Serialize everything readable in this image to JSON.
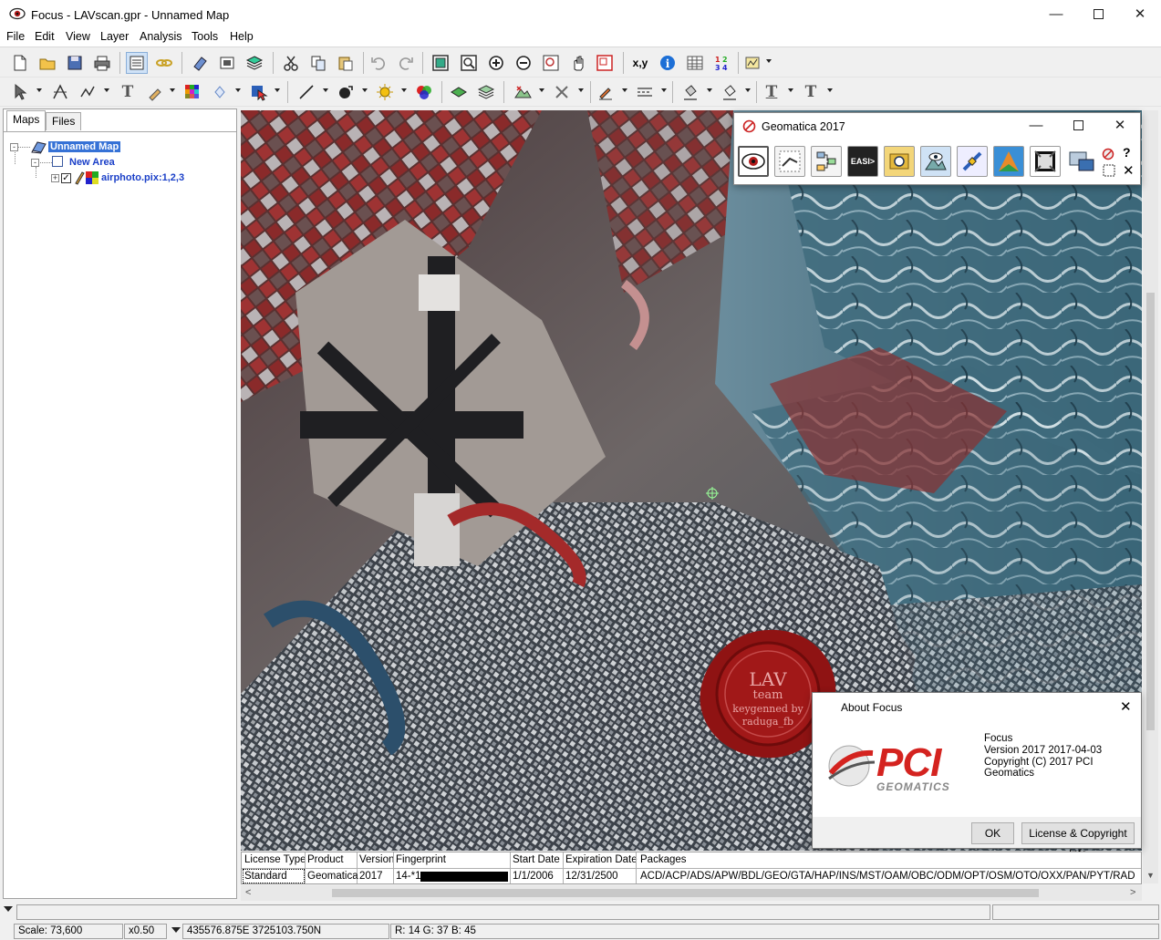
{
  "window": {
    "title": "Focus - LAVscan.gpr - Unnamed Map"
  },
  "menu": [
    "File",
    "Edit",
    "View",
    "Layer",
    "Analysis",
    "Tools",
    "Help"
  ],
  "left_panel": {
    "tabs": [
      "Maps",
      "Files"
    ],
    "tree": {
      "map": "Unnamed Map",
      "area": "New Area",
      "layer": "airphoto.pix:1,2,3"
    }
  },
  "geomatica_window": {
    "title": "Geomatica 2017"
  },
  "about_dialog": {
    "title": "About Focus",
    "product": "Focus",
    "version": "Version 2017 2017-04-03",
    "copyright": "Copyright (C) 2017 PCI Geomatics",
    "logo_text": "PCI",
    "logo_sub": "GEOMATICS",
    "ok_button": "OK",
    "license_button": "License & Copyright Info"
  },
  "seal": {
    "line1": "LAV",
    "line2": "team",
    "line3": "keygenned by",
    "line4": "raduga_fb"
  },
  "license_table": {
    "headers": [
      "License Type",
      "Product",
      "Version",
      "Fingerprint",
      "Start Date",
      "Expiration Date",
      "Packages"
    ],
    "row": [
      "Standard",
      "Geomatica",
      "2017",
      "14-*1",
      "1/1/2006",
      "12/31/2500",
      "ACD/ACP/ADS/APW/BDL/GEO/GTA/HAP/INS/MST/OAM/OBC/ODM/OPT/OSM/OTO/OXX/PAN/PYT/RAD"
    ]
  },
  "statusbar": {
    "scale": "Scale: 73,600",
    "zoom": "x0.50",
    "coords": "435576.875E 3725103.750N",
    "pixel": "R: 14 G: 37 B: 45"
  },
  "colors": {
    "selection": "#3672d6",
    "tree_text": "#1a3fc8",
    "seal": "#a11818",
    "pci_red": "#d4231f"
  }
}
